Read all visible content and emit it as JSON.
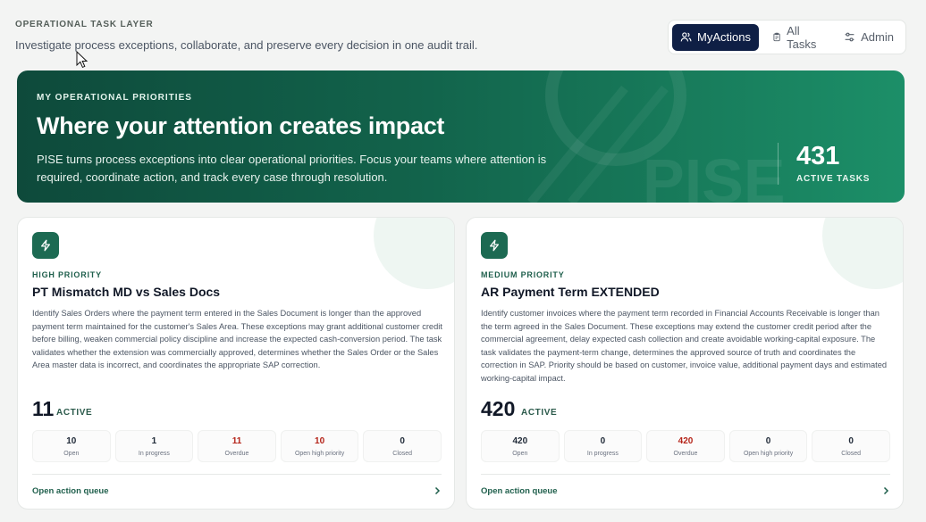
{
  "header": {
    "layer_label": "OPERATIONAL TASK LAYER",
    "description": "Investigate process exceptions, collaborate, and preserve every decision in one audit trail."
  },
  "nav": {
    "items": [
      {
        "label": "MyActions",
        "icon": "users-icon",
        "active": true
      },
      {
        "label": "All Tasks",
        "icon": "clipboard-icon",
        "active": false
      },
      {
        "label": "Admin",
        "icon": "sliders-icon",
        "active": false
      }
    ]
  },
  "hero": {
    "kicker": "MY OPERATIONAL PRIORITIES",
    "title": "Where your attention creates impact",
    "text": "PISE turns process exceptions into clear operational priorities. Focus your teams where attention is required, coordinate action, and track every case through resolution.",
    "count": "431",
    "count_label": "ACTIVE TASKS",
    "watermark": "PISE",
    "colors": {
      "start": "#0e4a3b",
      "end": "#1c8f68"
    }
  },
  "cards": [
    {
      "icon": "lightning-icon",
      "priority": "HIGH PRIORITY",
      "title": "PT Mismatch MD vs Sales Docs",
      "description": "Identify Sales Orders where the payment term entered in the Sales Document is longer than the approved payment term maintained for the customer's Sales Area. These exceptions may grant additional customer credit before billing, weaken commercial policy discipline and increase the expected cash-conversion period. The task validates whether the extension was commercially approved, determines whether the Sales Order or the Sales Area master data is incorrect, and coordinates the appropriate SAP correction.",
      "active_count": "11",
      "active_label": "ACTIVE",
      "stats": [
        {
          "value": "10",
          "label": "Open"
        },
        {
          "value": "1",
          "label": "In progress"
        },
        {
          "value": "11",
          "label": "Overdue"
        },
        {
          "value": "10",
          "label": "Open high priority"
        },
        {
          "value": "0",
          "label": "Closed"
        }
      ],
      "link_label": "Open action queue"
    },
    {
      "icon": "lightning-icon",
      "priority": "MEDIUM PRIORITY",
      "title": "AR Payment Term EXTENDED",
      "description": "Identify customer invoices where the payment term recorded in Financial Accounts Receivable is longer than the term agreed in the Sales Document. These exceptions may extend the customer credit period after the commercial agreement, delay expected cash collection and create avoidable working-capital exposure. The task validates the payment-term change, determines the approved source of truth and coordinates the correction in SAP. Priority should be based on customer, invoice value, additional payment days and estimated working-capital impact.",
      "active_count": "420",
      "active_label": "ACTIVE",
      "stats": [
        {
          "value": "420",
          "label": "Open"
        },
        {
          "value": "0",
          "label": "In progress"
        },
        {
          "value": "420",
          "label": "Overdue"
        },
        {
          "value": "0",
          "label": "Open high priority"
        },
        {
          "value": "0",
          "label": "Closed"
        }
      ],
      "link_label": "Open action queue"
    }
  ],
  "colors": {
    "accent": "#0f1f45",
    "overdue": "#b42318",
    "brand_green": "#1c6a52"
  }
}
